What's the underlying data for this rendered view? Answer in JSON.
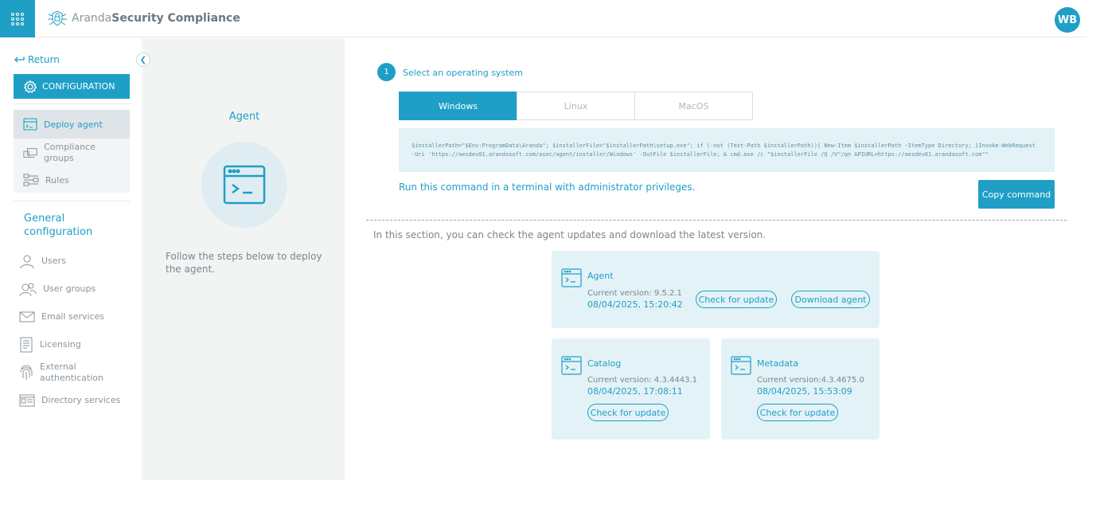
{
  "header": {
    "brand_light": "Aranda",
    "brand_bold": "Security Compliance",
    "avatar_initials": "WB"
  },
  "sidebar": {
    "return_label": "Return",
    "config_label": "CONFIGURATION",
    "sub_items": [
      {
        "label": "Deploy agent",
        "icon": "terminal-window-icon",
        "active": true
      },
      {
        "label": "Compliance groups",
        "icon": "devices-icon",
        "active": false
      },
      {
        "label": "Rules",
        "icon": "rules-icon",
        "active": false
      }
    ],
    "general_title": "General configuration",
    "general_items": [
      {
        "label": "Users",
        "icon": "user-icon"
      },
      {
        "label": "User groups",
        "icon": "user-groups-icon"
      },
      {
        "label": "Email services",
        "icon": "email-icon"
      },
      {
        "label": "Licensing",
        "icon": "license-document-icon"
      },
      {
        "label": "External authentication",
        "icon": "fingerprint-icon"
      },
      {
        "label": "Directory services",
        "icon": "directory-card-icon"
      }
    ]
  },
  "middle": {
    "title": "Agent",
    "description": "Follow the steps below to deploy the agent."
  },
  "main": {
    "step_number": "1",
    "step_label": "Select an operating system",
    "os_tabs": [
      {
        "label": "Windows",
        "active": true
      },
      {
        "label": "Linux",
        "active": false
      },
      {
        "label": "MacOS",
        "active": false
      }
    ],
    "command": "$installerPath=\"$Env:ProgramData\\Aranda\"; $installerFile=\"$installerPath\\setup.exe\"; if (-not (Test-Path $installerPath)){ New-Item $installerPath -ItemType Directory; }Invoke-WebRequest -Uri 'https://aesdev01.arandasoft.com/asec/agent/installer/Windows' -OutFile $installerFile; & cmd.exe /c \"$installerFile /Q /V\"/qn APIURL=https://aesdev01.arandasoft.com\"\"",
    "run_text": "Run this command in a terminal with administrator privileges.",
    "copy_button": "Copy command",
    "section_text": "In this section, you can check the agent updates and download the latest version.",
    "cards": {
      "agent": {
        "title": "Agent",
        "version": "Current version: 9.5.2.1",
        "date": "08/04/2025, 15:20:42",
        "check_button": "Check for update",
        "download_button": "Download agent"
      },
      "catalog": {
        "title": "Catalog",
        "version": "Current version: 4.3.4443.1",
        "date": "08/04/2025, 17:08:11",
        "check_button": "Check for update"
      },
      "metadata": {
        "title": "Metadata",
        "version": "Current version:4.3.4675.0",
        "date": "08/04/2025, 15:53:09",
        "check_button": "Check for update"
      }
    }
  },
  "colors": {
    "accent": "#1f9fc6",
    "card_bg": "#e3f2f6",
    "panel_bg": "#f2f4f4"
  }
}
